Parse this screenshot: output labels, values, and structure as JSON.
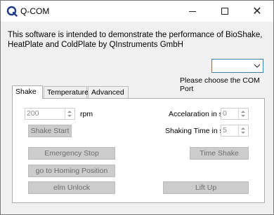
{
  "window": {
    "title": "Q-COM",
    "minimize_icon": "minimize-icon",
    "maximize_icon": "maximize-icon",
    "close_icon": "close-icon"
  },
  "intro_text": "This software is intended to demonstrate the performance of BioShake, HeatPlate and ColdPlate by QInstruments GmbH",
  "com_port": {
    "selected": "",
    "label": "Please choose the COM Port"
  },
  "tabs": [
    {
      "label": "Shake",
      "active": true
    },
    {
      "label": "Temperature",
      "active": false
    },
    {
      "label": "Advanced",
      "active": false
    }
  ],
  "shake": {
    "speed_value": "200",
    "speed_unit": "rpm",
    "shake_start": "Shake Start",
    "acceleration_label": "Accelaration in s",
    "acceleration_value": "0",
    "shaking_time_label": "Shaking Time in s",
    "shaking_time_value": "5",
    "emergency_stop": "Emergency Stop",
    "time_shake": "Time Shake",
    "homing": "go to Homing Position",
    "elm_unlock": "elm Unlock",
    "lift_up": "Lift Up"
  },
  "colors": {
    "window_bg": "#f0f0f0",
    "disabled_button": "#cccccc",
    "disabled_text": "#6d6d6d",
    "focus_border": "#3c7fb1",
    "logo": "#1f3a8a"
  }
}
